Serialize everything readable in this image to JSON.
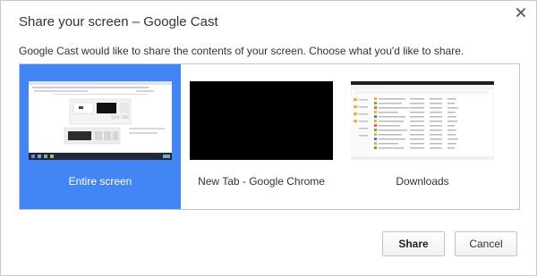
{
  "dialog": {
    "title": "Share your screen – Google Cast",
    "subtitle": "Google Cast would like to share the contents of your screen. Choose what you'd like to share."
  },
  "sources": [
    {
      "label": "Entire screen",
      "selected": true,
      "thumb_icon": "desktop-screenshot-thumbnail"
    },
    {
      "label": "New Tab - Google Chrome",
      "selected": false,
      "thumb_icon": "black-window-thumbnail"
    },
    {
      "label": "Downloads",
      "selected": false,
      "thumb_icon": "file-explorer-thumbnail"
    }
  ],
  "buttons": {
    "share": "Share",
    "cancel": "Cancel"
  },
  "colors": {
    "selection": "#4285f4",
    "border": "#c6c6c6",
    "text": "#333333"
  },
  "icons": {
    "close": "close-icon"
  }
}
